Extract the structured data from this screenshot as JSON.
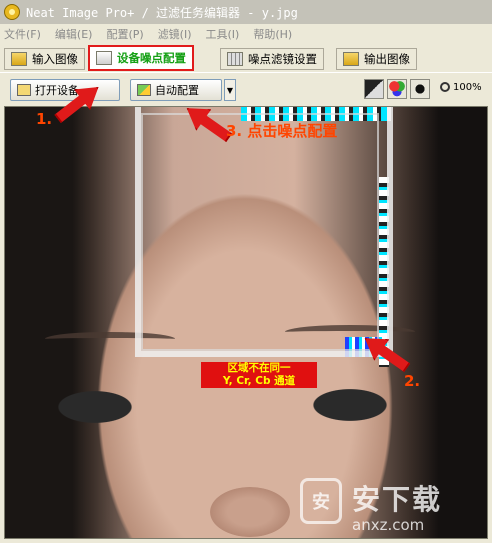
{
  "window": {
    "title": "Neat Image Pro+ / 过滤任务编辑器 - y.jpg"
  },
  "menu": [
    "文件(F)",
    "编辑(E)",
    "配置(P)",
    "滤镜(I)",
    "工具(I)",
    "帮助(H)"
  ],
  "tabs": [
    {
      "label": "输入图像",
      "icon": "image-icon"
    },
    {
      "label": "设备噪点配置",
      "icon": "monitor-icon",
      "active": true
    },
    {
      "label": "噪点滤镜设置",
      "icon": "filter-grid-icon"
    },
    {
      "label": "输出图像",
      "icon": "image-out-icon"
    }
  ],
  "toolbar": {
    "open_label": "打开设备",
    "auto_label": "自动配置",
    "zoom": "100%"
  },
  "annotations": {
    "step1": "1.",
    "step2": "2.",
    "step3": "3. 点击噪点配置"
  },
  "warning": {
    "line1": "区域不在同一",
    "line2": "Y, Cr, Cb 通道"
  },
  "watermark": {
    "badge": "安",
    "title": "安下载",
    "sub": "anxz.com"
  },
  "colors": {
    "active_tab_text": "#14a014",
    "annotation_red": "#e01a1a",
    "annotation_text": "#ff4500",
    "warning_bg": "#e01010"
  }
}
